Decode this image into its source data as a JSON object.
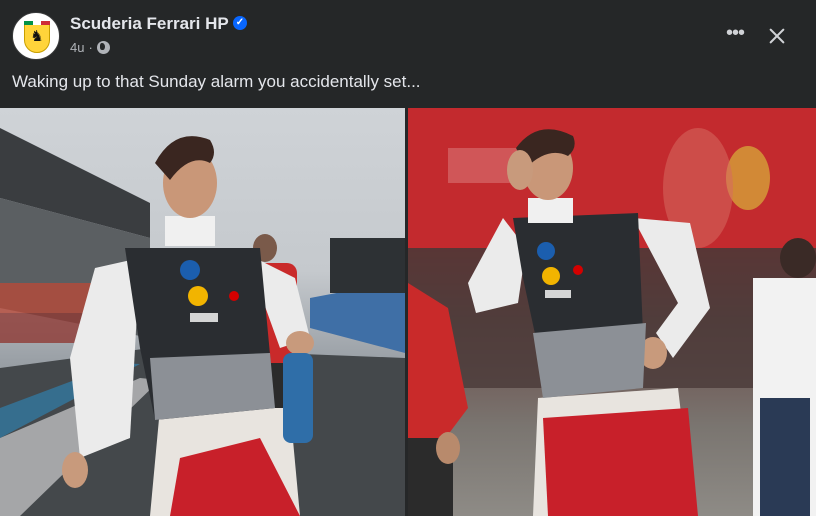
{
  "post": {
    "page_name": "Scuderia Ferrari HP",
    "time_ago": "4u",
    "separator": "·",
    "caption": "Waking up to that Sunday alarm you accidentally set...",
    "more_icon": "more-horizontal-icon",
    "close_icon": "close-icon",
    "verified_icon": "verified-badge-icon",
    "audience_icon": "globe-icon",
    "verified_glyph": "✓",
    "more_glyph": "•••"
  },
  "colors": {
    "background": "#252728",
    "text_primary": "#e4e6eb",
    "text_secondary": "#b0b3b8",
    "verified_blue": "#0866ff",
    "ferrari_red": "#d40000",
    "ferrari_yellow": "#ffd43a"
  },
  "photos": [
    {
      "name": "driver-on-grid-photo"
    },
    {
      "name": "driver-hand-on-head-photo"
    }
  ]
}
